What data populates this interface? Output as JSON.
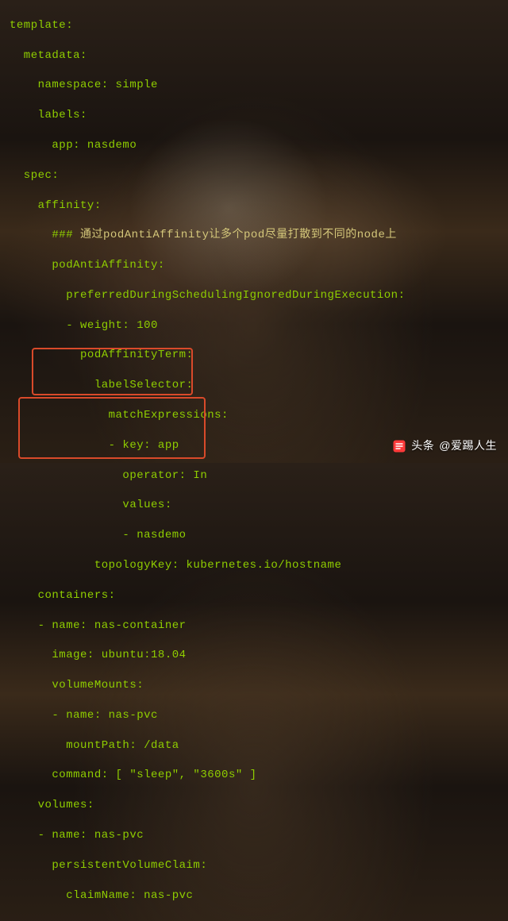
{
  "code": {
    "l01": "template:",
    "l02": "  metadata:",
    "l03": "    namespace: simple",
    "l04": "    labels:",
    "l05": "      app: nasdemo",
    "l06": "  spec:",
    "l07": "    affinity:",
    "l08_prefix": "      ### ",
    "l08_comment": "通过podAntiAffinity让多个pod尽量打散到不同的node上",
    "l09": "      podAntiAffinity:",
    "l10": "        preferredDuringSchedulingIgnoredDuringExecution:",
    "l11": "        - weight: 100",
    "l12": "          podAffinityTerm:",
    "l13": "            labelSelector:",
    "l14": "              matchExpressions:",
    "l15": "              - key: app",
    "l16": "                operator: In",
    "l17": "                values:",
    "l18": "                - nasdemo",
    "l19": "            topologyKey: kubernetes.io/hostname",
    "l20": "    containers:",
    "l21": "    - name: nas-container",
    "l22": "      image: ubuntu:18.04",
    "l23": "      volumeMounts:",
    "l24": "      - name: nas-pvc",
    "l25": "        mountPath: /data",
    "l26": "      command: [ \"sleep\", \"3600s\" ]",
    "l27": "    volumes:",
    "l28": "    - name: nas-pvc",
    "l29": "      persistentVolumeClaim:",
    "l30": "        claimName: nas-pvc"
  },
  "watermark": {
    "prefix": "头条",
    "handle": "@爱踢人生"
  }
}
